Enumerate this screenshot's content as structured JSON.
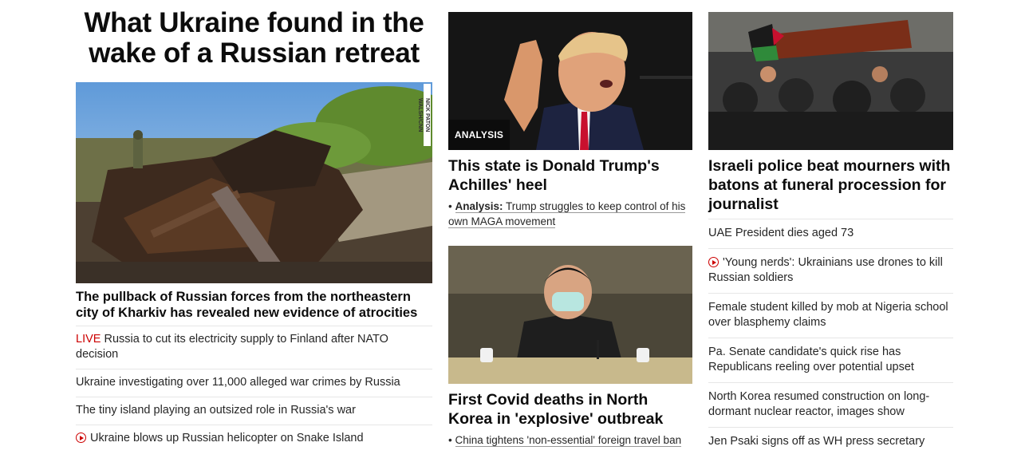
{
  "col1": {
    "headline": "What Ukraine found in the wake of a Russian retreat",
    "image_credit": "NICK PATON WALSH/CNN",
    "subhead": "The pullback of Russian forces from the northeastern city of Kharkiv has revealed new evidence of atrocities",
    "items": [
      {
        "prefix": "LIVE",
        "text": "Russia to cut its electricity supply to Finland after NATO decision",
        "video": false
      },
      {
        "prefix": "",
        "text": "Ukraine investigating over 11,000 alleged war crimes by Russia",
        "video": false
      },
      {
        "prefix": "",
        "text": "The tiny island playing an outsized role in Russia's war",
        "video": false
      },
      {
        "prefix": "",
        "text": "Ukraine blows up Russian helicopter on Snake Island",
        "video": true
      }
    ]
  },
  "col2": {
    "story1": {
      "badge": "ANALYSIS",
      "headline": "This state is Donald Trump's Achilles' heel",
      "bullet": "•",
      "sub_label": "Analysis:",
      "sub_text": "Trump struggles to keep control of his own MAGA movement"
    },
    "story2": {
      "headline": "First Covid deaths in North Korea in 'explosive' outbreak",
      "bullet": "•",
      "sub_text": "China tightens 'non-essential' foreign travel ban"
    }
  },
  "col3": {
    "headline": "Israeli police beat mourners with batons at funeral procession for journalist",
    "items": [
      {
        "text": "UAE President dies aged 73",
        "video": false
      },
      {
        "text": "'Young nerds': Ukrainians use drones to kill Russian soldiers",
        "video": true
      },
      {
        "text": "Female student killed by mob at Nigeria school over blasphemy claims",
        "video": false
      },
      {
        "text": "Pa. Senate candidate's quick rise has Republicans reeling over potential upset",
        "video": false
      },
      {
        "text": "North Korea resumed construction on long-dormant nuclear reactor, images show",
        "video": false
      },
      {
        "text": "Jen Psaki signs off as WH press secretary",
        "video": false
      }
    ]
  },
  "colors": {
    "accent_red": "#cc0000",
    "text": "#0c0c0c",
    "divider": "#e6e6e6",
    "badge_bg": "#0c0c0c"
  },
  "icons": {
    "video": "play-circle-icon"
  }
}
